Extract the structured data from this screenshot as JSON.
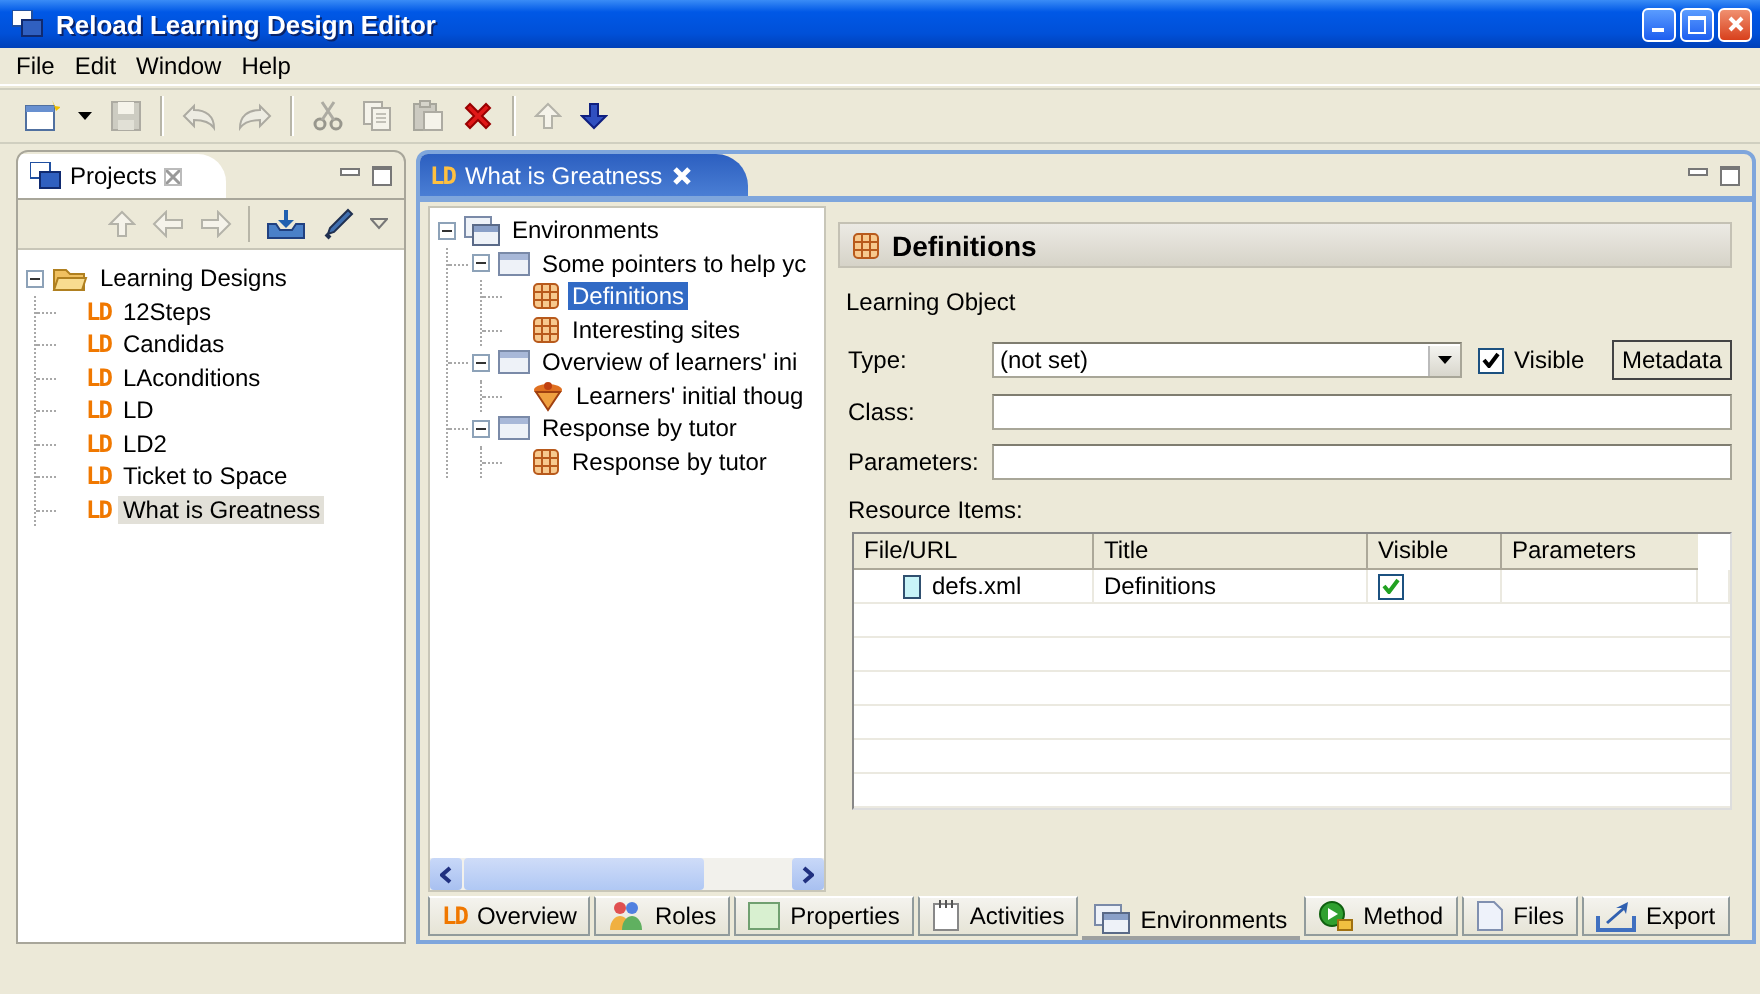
{
  "window": {
    "title": "Reload Learning Design Editor"
  },
  "menu": [
    "File",
    "Edit",
    "Window",
    "Help"
  ],
  "toolbar": [
    [
      {
        "kind": "new",
        "disabled": false
      },
      {
        "kind": "save",
        "disabled": true
      }
    ],
    [
      {
        "kind": "undo",
        "disabled": true
      },
      {
        "kind": "redo",
        "disabled": true
      }
    ],
    [
      {
        "kind": "cut",
        "disabled": true
      },
      {
        "kind": "copy",
        "disabled": true
      },
      {
        "kind": "paste",
        "disabled": true
      },
      {
        "kind": "delete",
        "disabled": false
      }
    ],
    [
      {
        "kind": "up",
        "disabled": true
      },
      {
        "kind": "down",
        "disabled": false
      }
    ]
  ],
  "projects": {
    "tab": "Projects",
    "toolbar": [
      [
        {
          "kind": "up",
          "disabled": true
        },
        {
          "kind": "back",
          "disabled": true
        },
        {
          "kind": "forward",
          "disabled": true
        }
      ],
      [
        {
          "kind": "import",
          "disabled": false
        },
        {
          "kind": "edit",
          "disabled": false
        }
      ]
    ],
    "tree": [
      {
        "label": "Learning Designs",
        "kind": "folder",
        "expanded": true,
        "selected": false,
        "children": [
          {
            "label": "12Steps",
            "kind": "ld",
            "badge": "LD",
            "selected": false
          },
          {
            "label": "Candidas",
            "kind": "ld",
            "badge": "LD",
            "selected": false
          },
          {
            "label": "LAconditions",
            "kind": "ld",
            "badge": "LD",
            "selected": false
          },
          {
            "label": "LD",
            "kind": "ld",
            "badge": "LD",
            "selected": false
          },
          {
            "label": "LD2",
            "kind": "ld",
            "badge": "LD",
            "selected": false
          },
          {
            "label": "Ticket to Space",
            "kind": "ld",
            "badge": "LD",
            "selected": false
          },
          {
            "label": "What is Greatness",
            "kind": "ld",
            "badge": "LD",
            "selected": true
          }
        ]
      }
    ]
  },
  "editor": {
    "tab": {
      "badge": "LD",
      "label": "What is Greatness"
    },
    "tree": [
      {
        "label": "Environments",
        "kind": "environments",
        "expanded": true,
        "selected": false,
        "children": [
          {
            "label": "Some pointers to help yc",
            "kind": "environment",
            "expanded": true,
            "selected": false,
            "children": [
              {
                "label": "Definitions",
                "kind": "learning-object",
                "selected": true
              },
              {
                "label": "Interesting sites",
                "kind": "learning-object",
                "selected": false
              }
            ]
          },
          {
            "label": "Overview of learners' ini",
            "kind": "environment",
            "expanded": true,
            "selected": false,
            "children": [
              {
                "label": "Learners' initial thoug",
                "kind": "service",
                "selected": false
              }
            ]
          },
          {
            "label": "Response by tutor",
            "kind": "environment",
            "expanded": true,
            "selected": false,
            "children": [
              {
                "label": "Response by tutor",
                "kind": "learning-object",
                "selected": false
              }
            ]
          }
        ]
      }
    ],
    "form": {
      "title": "Definitions",
      "subtitle": "Learning Object",
      "type": {
        "label": "Type:",
        "value": "(not set)"
      },
      "visible": {
        "label": "Visible",
        "checked": true
      },
      "metadata_button": "Metadata",
      "class": {
        "label": "Class:"
      },
      "parameters": {
        "label": "Parameters:"
      },
      "resources": {
        "label": "Resource Items:",
        "columns": [
          "File/URL",
          "Title",
          "Visible",
          "Parameters"
        ],
        "rows": [
          {
            "file": "defs.xml",
            "title": "Definitions",
            "visible": true
          }
        ]
      }
    },
    "tabs": [
      {
        "label": "Overview",
        "kind": "overview",
        "badge": "LD",
        "selected": false
      },
      {
        "label": "Roles",
        "kind": "roles",
        "selected": false
      },
      {
        "label": "Properties",
        "kind": "properties",
        "selected": false
      },
      {
        "label": "Activities",
        "kind": "activities",
        "selected": false
      },
      {
        "label": "Environments",
        "kind": "environments",
        "selected": true
      },
      {
        "label": "Method",
        "kind": "method",
        "selected": false
      },
      {
        "label": "Files",
        "kind": "files",
        "selected": false
      },
      {
        "label": "Export",
        "kind": "export",
        "selected": false
      }
    ]
  }
}
